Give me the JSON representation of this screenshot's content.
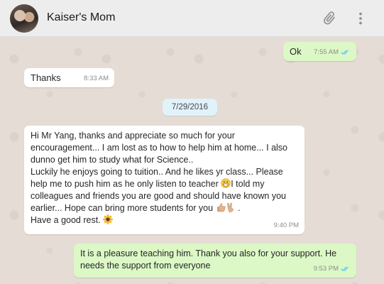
{
  "header": {
    "contact_name": "Kaiser's Mom"
  },
  "messages": [
    {
      "direction": "outgoing",
      "text": "Ok",
      "time": "7:55 AM",
      "status": "read"
    },
    {
      "direction": "incoming",
      "text": "Thanks",
      "time": "8:33 AM"
    },
    {
      "type": "date_divider",
      "text": "7/29/2016"
    },
    {
      "direction": "incoming",
      "lines": [
        "Hi Mr Yang, thanks and appreciate so much for your",
        "encouragement... I am lost as to how to help him at home... I also",
        "dunno get him to study what for Science..",
        "Luckily he enjoys going to tuition.. And he likes yr class... Please",
        "help me to push him as he only listen to teacher",
        "I told my",
        "colleagues and friends you are good and should have known you",
        "earlier... Hope can bring more students for you",
        ".",
        "Have a good rest."
      ],
      "emoji": [
        "grinning-face",
        "thumbs-up",
        "victory-hand",
        "sunflower"
      ],
      "time": "9:40 PM"
    },
    {
      "direction": "outgoing",
      "lines": [
        "It is a pleasure teaching him. Thank you also for your support. He",
        "needs the support from everyone"
      ],
      "time": "9:53 PM",
      "status": "read"
    }
  ],
  "colors": {
    "chat_bg": "#e5ddd5",
    "outgoing_bubble": "#dcf8c6",
    "incoming_bubble": "#ffffff",
    "read_ticks": "#4fc3f7",
    "date_pill": "#e1f2fb"
  }
}
